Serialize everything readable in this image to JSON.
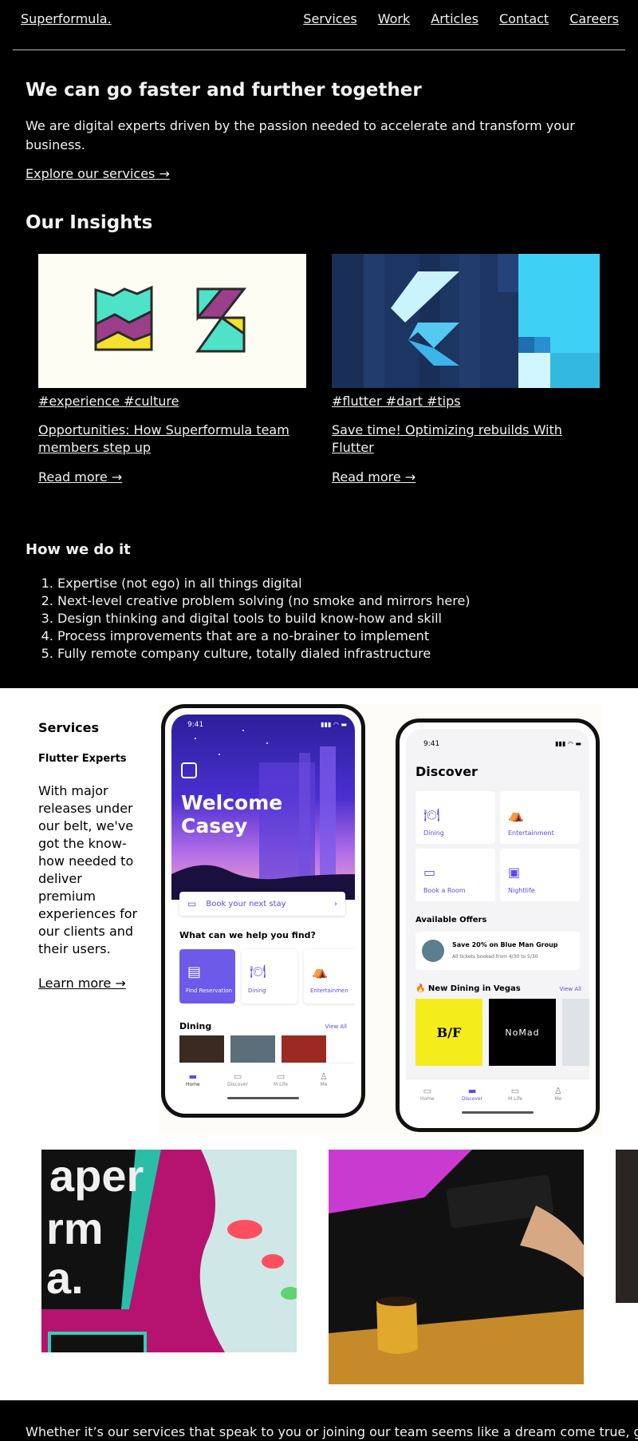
{
  "header": {
    "logo": "Superformula.",
    "nav": [
      "Services",
      "Work",
      "Articles",
      "Contact",
      "Careers"
    ]
  },
  "hero": {
    "title": "We can go faster and further together",
    "text": "We are digital experts driven by the passion needed to accelerate and transform your business.",
    "cta": "Explore our services →"
  },
  "insights": {
    "title": "Our Insights",
    "cards": [
      {
        "tags": "#experience #culture",
        "title": "Opportunities: How Superformula team members step up",
        "more": "Read more →"
      },
      {
        "tags": "#flutter #dart #tips",
        "title": "Save time! Optimizing rebuilds With Flutter",
        "more": "Read more →"
      }
    ]
  },
  "how": {
    "title": "How we do it",
    "items": [
      "Expertise (not ego) in all things digital",
      "Next-level creative problem solving (no smoke and mirrors here)",
      "Design thinking and digital tools to build know-how and skill",
      "Process improvements that are a no-brainer to implement",
      "Fully remote company culture, totally dialed infrastructure"
    ]
  },
  "services": {
    "title": "Services",
    "subtitle": "Flutter Experts",
    "text": "With major releases under our belt, we've got the know-how needed to deliver premium experiences for our clients and their users.",
    "cta": "Learn more →"
  },
  "phone1": {
    "time": "9:41",
    "welcome": "Welcome Casey",
    "book": "Book your next stay",
    "help": "What can we help you find?",
    "tiles": [
      "Find Reservation",
      "Dining",
      "Entertainmen"
    ],
    "dining": "Dining",
    "view_all": "View All",
    "tabs": [
      "Home",
      "Discover",
      "M Life",
      "Me"
    ]
  },
  "phone2": {
    "time": "9:41",
    "title": "Discover",
    "tiles": [
      "Dining",
      "Entertainment",
      "Book a Room",
      "Nightlife"
    ],
    "offers_title": "Available Offers",
    "offer_title": "Save 20% on Blue Man Group",
    "offer_sub": "All tickets booked from 4/30 to 5/30",
    "new_dining": "🔥 New Dining in Vegas",
    "view_all": "View All",
    "restaurants": [
      "B/F",
      "NoMad"
    ],
    "tabs": [
      "Home",
      "Discover",
      "M Life",
      "Me"
    ]
  },
  "footer": {
    "text": "Whether it’s our services that speak to you or joining our team seems like a dream come true, get"
  },
  "colors": {
    "accent": "#5b4be8",
    "flutter_dark": "#1d3563",
    "flutter_light": "#3fd0f5",
    "pink": "#b5136f"
  }
}
